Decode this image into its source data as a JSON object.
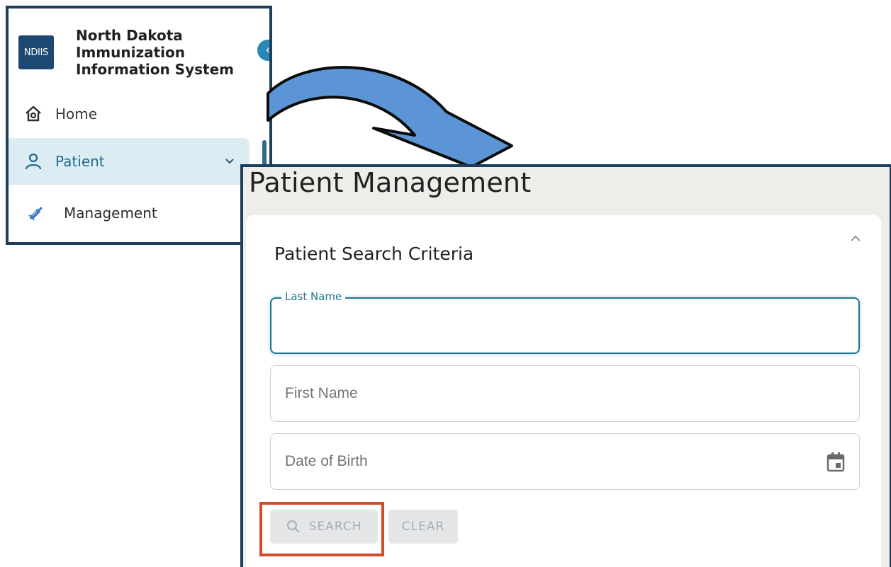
{
  "sidebar": {
    "logo_text": "NDIIS",
    "app_name_line1": "North Dakota",
    "app_name_line2": "Immunization",
    "app_name_line3": "Information System",
    "collapse_icon": "chevron-left-icon",
    "items": [
      {
        "label": "Home",
        "icon": "home-icon"
      },
      {
        "label": "Patient",
        "icon": "person-icon",
        "expanded": true
      },
      {
        "label": "Management",
        "icon": "syringe-icon"
      }
    ]
  },
  "main": {
    "title": "Patient Management",
    "card": {
      "title": "Patient Search Criteria",
      "fields": {
        "last_name": {
          "label": "Last Name",
          "value": ""
        },
        "first_name": {
          "placeholder": "First Name"
        },
        "dob": {
          "placeholder": "Date of Birth",
          "icon": "calendar-icon"
        }
      },
      "buttons": {
        "search": "SEARCH",
        "clear": "CLEAR"
      }
    }
  },
  "colors": {
    "brand": "#1d4a73",
    "accent": "#1f7690",
    "highlight": "#d24a2a",
    "arrow": "#5b95d6"
  }
}
